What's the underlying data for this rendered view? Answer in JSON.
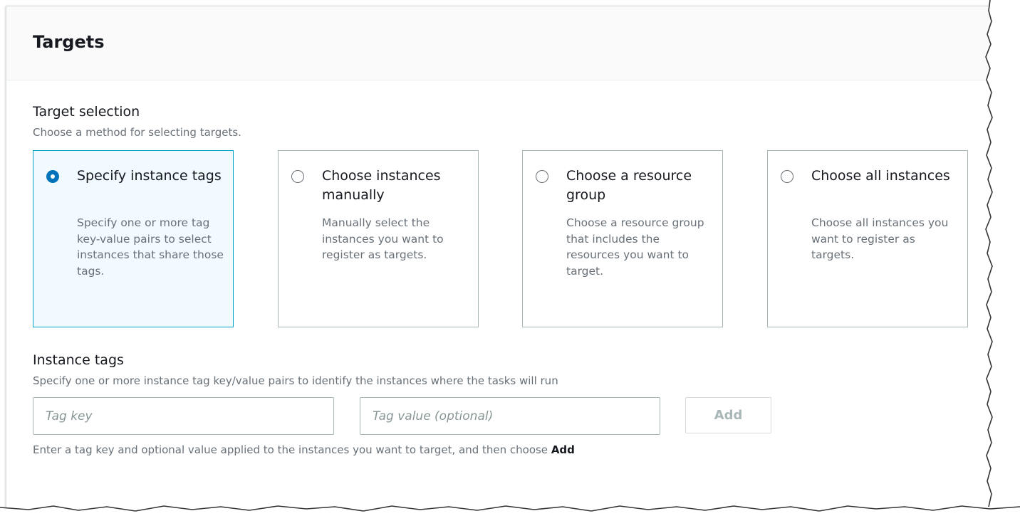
{
  "panel": {
    "title": "Targets"
  },
  "target_selection": {
    "label": "Target selection",
    "description": "Choose a method for selecting targets.",
    "options": [
      {
        "title": "Specify instance tags",
        "description": "Specify one or more tag key-value pairs to select instances that share those tags.",
        "selected": true
      },
      {
        "title": "Choose instances manually",
        "description": "Manually select the instances you want to register as targets.",
        "selected": false
      },
      {
        "title": "Choose a resource group",
        "description": "Choose a resource group that includes the resources you want to target.",
        "selected": false
      },
      {
        "title": "Choose all instances",
        "description": "Choose all instances you want to register as targets.",
        "selected": false
      }
    ]
  },
  "instance_tags": {
    "label": "Instance tags",
    "description": "Specify one or more instance tag key/value pairs to identify the instances where the tasks will run",
    "key_placeholder": "Tag key",
    "key_value": "",
    "value_placeholder": "Tag value (optional)",
    "value_value": "",
    "add_label": "Add",
    "hint_prefix": "Enter a tag key and optional value applied to the instances you want to target, and then choose ",
    "hint_emphasis": "Add"
  },
  "colors": {
    "accent": "#0073bb",
    "selected_border": "#00a1c9",
    "selected_background": "#f1faff",
    "secondary_text": "#687078"
  }
}
